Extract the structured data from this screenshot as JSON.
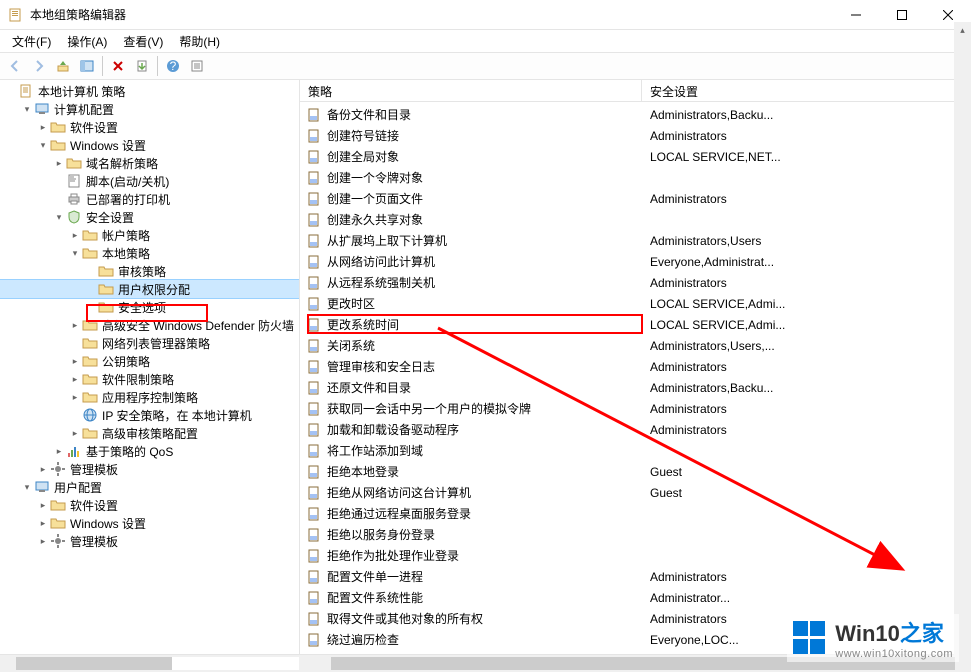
{
  "titlebar": {
    "title": "本地组策略编辑器"
  },
  "menu": {
    "file": "文件(F)",
    "action": "操作(A)",
    "view": "查看(V)",
    "help": "帮助(H)"
  },
  "tree": {
    "root": "本地计算机 策略",
    "computer_config": "计算机配置",
    "software_settings": "软件设置",
    "windows_settings": "Windows 设置",
    "name_resolution": "域名解析策略",
    "scripts": "脚本(启动/关机)",
    "deployed_printers": "已部署的打印机",
    "security_settings": "安全设置",
    "account_policies": "帐户策略",
    "local_policies": "本地策略",
    "audit_policy": "审核策略",
    "user_rights": "用户权限分配",
    "security_options": "安全选项",
    "advanced_wd": "高级安全 Windows Defender 防火墙",
    "network_list": "网络列表管理器策略",
    "public_key": "公钥策略",
    "software_restrict": "软件限制策略",
    "app_control": "应用程序控制策略",
    "ip_security": "IP 安全策略，在 本地计算机",
    "advanced_audit": "高级审核策略配置",
    "policy_qos": "基于策略的 QoS",
    "admin_templates": "管理模板",
    "user_config": "用户配置",
    "user_software": "软件设置",
    "user_windows": "Windows 设置",
    "user_templates": "管理模板"
  },
  "list_headers": {
    "policy": "策略",
    "security": "安全设置"
  },
  "policies": [
    {
      "name": "备份文件和目录",
      "setting": "Administrators,Backu..."
    },
    {
      "name": "创建符号链接",
      "setting": "Administrators"
    },
    {
      "name": "创建全局对象",
      "setting": "LOCAL SERVICE,NET..."
    },
    {
      "name": "创建一个令牌对象",
      "setting": ""
    },
    {
      "name": "创建一个页面文件",
      "setting": "Administrators"
    },
    {
      "name": "创建永久共享对象",
      "setting": ""
    },
    {
      "name": "从扩展坞上取下计算机",
      "setting": "Administrators,Users"
    },
    {
      "name": "从网络访问此计算机",
      "setting": "Everyone,Administrat..."
    },
    {
      "name": "从远程系统强制关机",
      "setting": "Administrators"
    },
    {
      "name": "更改时区",
      "setting": "LOCAL SERVICE,Admi..."
    },
    {
      "name": "更改系统时间",
      "setting": "LOCAL SERVICE,Admi..."
    },
    {
      "name": "关闭系统",
      "setting": "Administrators,Users,..."
    },
    {
      "name": "管理审核和安全日志",
      "setting": "Administrators"
    },
    {
      "name": "还原文件和目录",
      "setting": "Administrators,Backu..."
    },
    {
      "name": "获取同一会话中另一个用户的模拟令牌",
      "setting": "Administrators"
    },
    {
      "name": "加载和卸载设备驱动程序",
      "setting": "Administrators"
    },
    {
      "name": "将工作站添加到域",
      "setting": ""
    },
    {
      "name": "拒绝本地登录",
      "setting": "Guest"
    },
    {
      "name": "拒绝从网络访问这台计算机",
      "setting": "Guest"
    },
    {
      "name": "拒绝通过远程桌面服务登录",
      "setting": ""
    },
    {
      "name": "拒绝以服务身份登录",
      "setting": ""
    },
    {
      "name": "拒绝作为批处理作业登录",
      "setting": ""
    },
    {
      "name": "配置文件单一进程",
      "setting": "Administrators"
    },
    {
      "name": "配置文件系统性能",
      "setting": "Administrator..."
    },
    {
      "name": "取得文件或其他对象的所有权",
      "setting": "Administrators"
    },
    {
      "name": "绕过遍历检查",
      "setting": "Everyone,LOC..."
    }
  ],
  "watermark": {
    "brand": "Win10",
    "suffix": "之家",
    "url": "www.win10xitong.com"
  },
  "colors": {
    "accent": "#0078d7",
    "highlight_box": "#ff0000"
  }
}
